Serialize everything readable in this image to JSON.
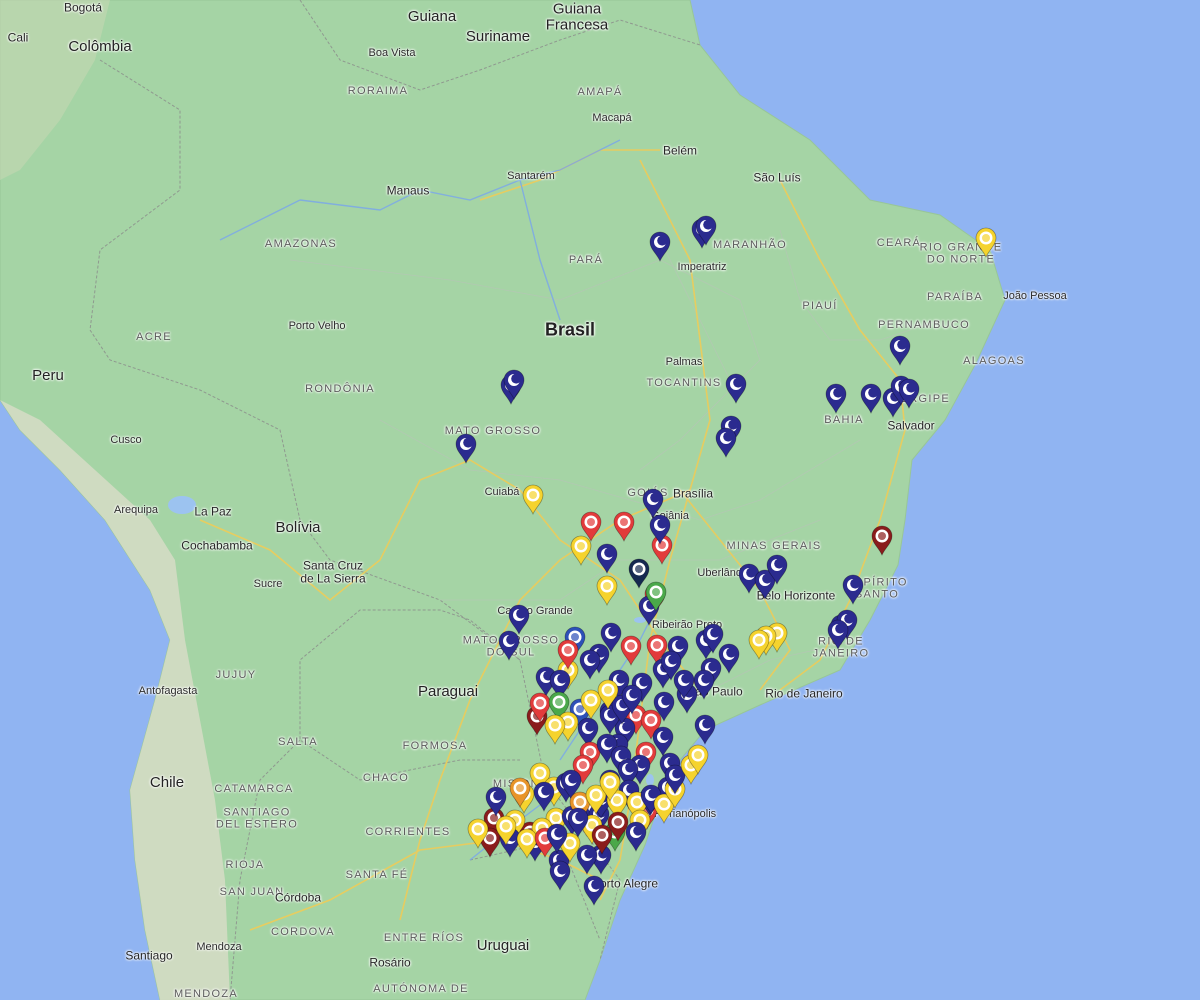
{
  "map": {
    "labels": [
      {
        "text": "Bogotá",
        "cls": "city"
      },
      {
        "text": "Cali",
        "cls": "city"
      },
      {
        "text": "Colômbia",
        "cls": "country"
      },
      {
        "text": "Guiana",
        "cls": "country"
      },
      {
        "text": "Suriname",
        "cls": "country"
      },
      {
        "text": "Guiana\nFrancesa",
        "cls": "country"
      },
      {
        "text": "Boa Vista",
        "cls": "ocity"
      },
      {
        "text": "RORAIMA",
        "cls": "state"
      },
      {
        "text": "AMAPÁ",
        "cls": "state"
      },
      {
        "text": "Macapá",
        "cls": "ocity"
      },
      {
        "text": "Belém",
        "cls": "city"
      },
      {
        "text": "São Luís",
        "cls": "city"
      },
      {
        "text": "Santarém",
        "cls": "ocity"
      },
      {
        "text": "Manaus",
        "cls": "city"
      },
      {
        "text": "AMAZONAS",
        "cls": "state"
      },
      {
        "text": "PARÁ",
        "cls": "state"
      },
      {
        "text": "MARANHÃO",
        "cls": "state"
      },
      {
        "text": "Imperatriz",
        "cls": "ocity"
      },
      {
        "text": "CEARÁ",
        "cls": "state"
      },
      {
        "text": "RIO GRANDE\nDO NORTE",
        "cls": "state"
      },
      {
        "text": "PARAÍBA",
        "cls": "state"
      },
      {
        "text": "João Pessoa",
        "cls": "ocity"
      },
      {
        "text": "PIAUÍ",
        "cls": "state"
      },
      {
        "text": "PERNAMBUCO",
        "cls": "state"
      },
      {
        "text": "ALAGOAS",
        "cls": "state"
      },
      {
        "text": "Brasil",
        "cls": "big"
      },
      {
        "text": "Porto Velho",
        "cls": "ocity"
      },
      {
        "text": "ACRE",
        "cls": "state"
      },
      {
        "text": "Palmas",
        "cls": "ocity"
      },
      {
        "text": "TOCANTINS",
        "cls": "state"
      },
      {
        "text": "RONDÔNIA",
        "cls": "state"
      },
      {
        "text": "Peru",
        "cls": "country"
      },
      {
        "text": "BAHIA",
        "cls": "state"
      },
      {
        "text": "SERGIPE",
        "cls": "state"
      },
      {
        "text": "Salvador",
        "cls": "city"
      },
      {
        "text": "MATO GROSSO",
        "cls": "state"
      },
      {
        "text": "Cusco",
        "cls": "ocity"
      },
      {
        "text": "Cuiabá",
        "cls": "ocity"
      },
      {
        "text": "GOIÁS",
        "cls": "state"
      },
      {
        "text": "Brasília",
        "cls": "city"
      },
      {
        "text": "Goiânia",
        "cls": "ocity"
      },
      {
        "text": "Arequipa",
        "cls": "ocity"
      },
      {
        "text": "La Paz",
        "cls": "city"
      },
      {
        "text": "Bolívia",
        "cls": "country"
      },
      {
        "text": "Cochabamba",
        "cls": "city"
      },
      {
        "text": "MINAS GERAIS",
        "cls": "state"
      },
      {
        "text": "Uberlândia",
        "cls": "ocity"
      },
      {
        "text": "Santa Cruz\nde La Sierra",
        "cls": "city"
      },
      {
        "text": "Sucre",
        "cls": "ocity"
      },
      {
        "text": "Belo Horizonte",
        "cls": "city"
      },
      {
        "text": "ESPÍRITO\nSANTO",
        "cls": "state"
      },
      {
        "text": "Campo Grande",
        "cls": "ocity"
      },
      {
        "text": "Ribeirão Preto",
        "cls": "ocity"
      },
      {
        "text": "MATO GROSSO\nDO SUL",
        "cls": "state"
      },
      {
        "text": "RIO DE\nJANEIRO",
        "cls": "state"
      },
      {
        "text": "Antofagasta",
        "cls": "ocity"
      },
      {
        "text": "JUJUY",
        "cls": "state"
      },
      {
        "text": "Paraguai",
        "cls": "country"
      },
      {
        "text": "São Paulo",
        "cls": "city"
      },
      {
        "text": "Rio de Janeiro",
        "cls": "city"
      },
      {
        "text": "SALTA",
        "cls": "state"
      },
      {
        "text": "FORMOSA",
        "cls": "state"
      },
      {
        "text": "Chile",
        "cls": "country"
      },
      {
        "text": "CHACO",
        "cls": "state"
      },
      {
        "text": "CATAMARCA",
        "cls": "state"
      },
      {
        "text": "SANTIAGO\nDEL ESTERO",
        "cls": "state"
      },
      {
        "text": "MISIONES",
        "cls": "state"
      },
      {
        "text": "Florianópolis",
        "cls": "ocity"
      },
      {
        "text": "CORRIENTES",
        "cls": "state"
      },
      {
        "text": "RIOJA",
        "cls": "state"
      },
      {
        "text": "SANTA FÉ",
        "cls": "state"
      },
      {
        "text": "SAN JUAN",
        "cls": "state"
      },
      {
        "text": "Porto Alegre",
        "cls": "city"
      },
      {
        "text": "Córdoba",
        "cls": "city"
      },
      {
        "text": "CORDOVA",
        "cls": "state"
      },
      {
        "text": "ENTRE RÍOS",
        "cls": "state"
      },
      {
        "text": "Uruguai",
        "cls": "country"
      },
      {
        "text": "Santiago",
        "cls": "city"
      },
      {
        "text": "Mendoza",
        "cls": "ocity"
      },
      {
        "text": "Rosário",
        "cls": "city"
      },
      {
        "text": "MENDOZA",
        "cls": "state"
      },
      {
        "text": "AUTÓNOMA DE",
        "cls": "state"
      }
    ],
    "pin_colors": {
      "navy": "#2b2b8f",
      "red": "#e23b3b",
      "yellow": "#f5d32e",
      "maroon": "#8a1c1c",
      "green": "#4aa84a",
      "orange": "#e8942a",
      "darknavy": "#152850",
      "royal": "#2d50b8"
    },
    "markers": [
      {
        "color": "navy",
        "icon": "moon"
      },
      {
        "color": "navy",
        "icon": "moon"
      },
      {
        "color": "navy",
        "icon": "moon"
      },
      {
        "color": "yellow",
        "icon": "logo"
      },
      {
        "color": "navy",
        "icon": "moon"
      },
      {
        "color": "navy",
        "icon": "moon"
      },
      {
        "color": "navy",
        "icon": "moon"
      },
      {
        "color": "navy",
        "icon": "moon"
      },
      {
        "color": "navy",
        "icon": "moon"
      },
      {
        "color": "navy",
        "icon": "moon"
      },
      {
        "color": "navy",
        "icon": "moon"
      },
      {
        "color": "navy",
        "icon": "moon"
      },
      {
        "color": "navy",
        "icon": "moon"
      },
      {
        "color": "navy",
        "icon": "moon"
      },
      {
        "color": "navy",
        "icon": "moon"
      },
      {
        "color": "navy",
        "icon": "moon"
      },
      {
        "color": "yellow",
        "icon": "logo"
      },
      {
        "color": "navy",
        "icon": "moon"
      },
      {
        "color": "maroon",
        "icon": "logo"
      },
      {
        "color": "red",
        "icon": "logo"
      },
      {
        "color": "red",
        "icon": "logo"
      },
      {
        "color": "red",
        "icon": "logo"
      },
      {
        "color": "navy",
        "icon": "moon"
      },
      {
        "color": "yellow",
        "icon": "logo"
      },
      {
        "color": "navy",
        "icon": "moon"
      },
      {
        "color": "darknavy",
        "icon": "logo"
      },
      {
        "color": "yellow",
        "icon": "logo"
      },
      {
        "color": "red",
        "icon": "logo"
      },
      {
        "color": "navy",
        "icon": "moon"
      },
      {
        "color": "navy",
        "icon": "moon"
      },
      {
        "color": "navy",
        "icon": "moon"
      },
      {
        "color": "navy",
        "icon": "moon"
      },
      {
        "color": "navy",
        "icon": "moon"
      },
      {
        "color": "navy",
        "icon": "moon"
      },
      {
        "color": "navy",
        "icon": "moon"
      },
      {
        "color": "navy",
        "icon": "moon"
      },
      {
        "color": "navy",
        "icon": "moon"
      },
      {
        "color": "navy",
        "icon": "moon"
      },
      {
        "color": "green",
        "icon": "logo"
      },
      {
        "color": "navy",
        "icon": "moon"
      },
      {
        "color": "navy",
        "icon": "moon"
      },
      {
        "color": "yellow",
        "icon": "logo"
      },
      {
        "color": "yellow",
        "icon": "logo"
      },
      {
        "color": "yellow",
        "icon": "logo"
      },
      {
        "color": "royal",
        "icon": "logo"
      },
      {
        "color": "red",
        "icon": "logo"
      },
      {
        "color": "navy",
        "icon": "moon"
      },
      {
        "color": "red",
        "icon": "logo"
      },
      {
        "color": "navy",
        "icon": "moon"
      },
      {
        "color": "navy",
        "icon": "moon"
      },
      {
        "color": "navy",
        "icon": "moon"
      },
      {
        "color": "navy",
        "icon": "moon"
      },
      {
        "color": "navy",
        "icon": "moon"
      },
      {
        "color": "navy",
        "icon": "moon"
      },
      {
        "color": "navy",
        "icon": "moon"
      },
      {
        "color": "navy",
        "icon": "moon"
      },
      {
        "color": "navy",
        "icon": "moon"
      },
      {
        "color": "yellow",
        "icon": "logo"
      },
      {
        "color": "red",
        "icon": "logo"
      },
      {
        "color": "navy",
        "icon": "moon"
      },
      {
        "color": "navy",
        "icon": "moon"
      },
      {
        "color": "navy",
        "icon": "moon"
      },
      {
        "color": "navy",
        "icon": "moon"
      },
      {
        "color": "navy",
        "icon": "moon"
      },
      {
        "color": "maroon",
        "icon": "logo"
      },
      {
        "color": "red",
        "icon": "logo"
      },
      {
        "color": "green",
        "icon": "logo"
      },
      {
        "color": "royal",
        "icon": "logo"
      },
      {
        "color": "navy",
        "icon": "moon"
      },
      {
        "color": "navy",
        "icon": "moon"
      },
      {
        "color": "yellow",
        "icon": "logo"
      },
      {
        "color": "red",
        "icon": "logo"
      },
      {
        "color": "red",
        "icon": "logo"
      },
      {
        "color": "navy",
        "icon": "moon"
      },
      {
        "color": "navy",
        "icon": "moon"
      },
      {
        "color": "red",
        "icon": "logo"
      },
      {
        "color": "navy",
        "icon": "moon"
      },
      {
        "color": "navy",
        "icon": "moon"
      },
      {
        "color": "navy",
        "icon": "moon"
      },
      {
        "color": "red",
        "icon": "logo"
      },
      {
        "color": "navy",
        "icon": "moon"
      },
      {
        "color": "navy",
        "icon": "moon"
      },
      {
        "color": "navy",
        "icon": "moon"
      },
      {
        "color": "navy",
        "icon": "moon"
      },
      {
        "color": "navy",
        "icon": "moon"
      },
      {
        "color": "yellow",
        "icon": "logo"
      },
      {
        "color": "yellow",
        "icon": "logo"
      },
      {
        "color": "navy",
        "icon": "moon"
      },
      {
        "color": "red",
        "icon": "logo"
      },
      {
        "color": "navy",
        "icon": "moon"
      },
      {
        "color": "yellow",
        "icon": "logo"
      },
      {
        "color": "navy",
        "icon": "moon"
      },
      {
        "color": "navy",
        "icon": "moon"
      },
      {
        "color": "red",
        "icon": "logo"
      },
      {
        "color": "navy",
        "icon": "moon"
      },
      {
        "color": "navy",
        "icon": "moon"
      },
      {
        "color": "navy",
        "icon": "moon"
      },
      {
        "color": "navy",
        "icon": "moon"
      },
      {
        "color": "navy",
        "icon": "moon"
      },
      {
        "color": "yellow",
        "icon": "logo"
      },
      {
        "color": "navy",
        "icon": "moon"
      },
      {
        "color": "maroon",
        "icon": "logo"
      },
      {
        "color": "yellow",
        "icon": "logo"
      },
      {
        "color": "yellow",
        "icon": "logo"
      },
      {
        "color": "yellow",
        "icon": "logo"
      },
      {
        "color": "maroon",
        "icon": "logo"
      },
      {
        "color": "maroon",
        "icon": "logo"
      },
      {
        "color": "navy",
        "icon": "moon"
      },
      {
        "color": "yellow",
        "icon": "logo"
      },
      {
        "color": "red",
        "icon": "logo"
      },
      {
        "color": "navy",
        "icon": "moon"
      },
      {
        "color": "navy",
        "icon": "moon"
      },
      {
        "color": "navy",
        "icon": "moon"
      },
      {
        "color": "navy",
        "icon": "moon"
      },
      {
        "color": "navy",
        "icon": "moon"
      },
      {
        "color": "yellow",
        "icon": "logo"
      },
      {
        "color": "yellow",
        "icon": "logo"
      },
      {
        "color": "navy",
        "icon": "moon"
      },
      {
        "color": "yellow",
        "icon": "logo"
      },
      {
        "color": "yellow",
        "icon": "logo"
      },
      {
        "color": "yellow",
        "icon": "logo"
      },
      {
        "color": "green",
        "icon": "logo"
      },
      {
        "color": "navy",
        "icon": "moon"
      },
      {
        "color": "navy",
        "icon": "moon"
      },
      {
        "color": "yellow",
        "icon": "logo"
      },
      {
        "color": "yellow",
        "icon": "logo"
      },
      {
        "color": "navy",
        "icon": "moon"
      },
      {
        "color": "orange",
        "icon": "logo"
      },
      {
        "color": "orange",
        "icon": "logo"
      },
      {
        "color": "yellow",
        "icon": "logo"
      },
      {
        "color": "yellow",
        "icon": "logo"
      },
      {
        "color": "navy",
        "icon": "moon"
      },
      {
        "color": "maroon",
        "icon": "logo"
      },
      {
        "color": "maroon",
        "icon": "logo"
      },
      {
        "color": "yellow",
        "icon": "logo"
      },
      {
        "color": "navy",
        "icon": "moon"
      },
      {
        "color": "navy",
        "icon": "moon"
      },
      {
        "color": "yellow",
        "icon": "logo"
      },
      {
        "color": "yellow",
        "icon": "logo"
      },
      {
        "color": "navy",
        "icon": "moon"
      },
      {
        "color": "navy",
        "icon": "moon"
      },
      {
        "color": "navy",
        "icon": "moon"
      },
      {
        "color": "navy",
        "icon": "moon"
      },
      {
        "color": "yellow",
        "icon": "logo"
      },
      {
        "color": "yellow",
        "icon": "logo"
      },
      {
        "color": "yellow",
        "icon": "logo"
      }
    ]
  }
}
